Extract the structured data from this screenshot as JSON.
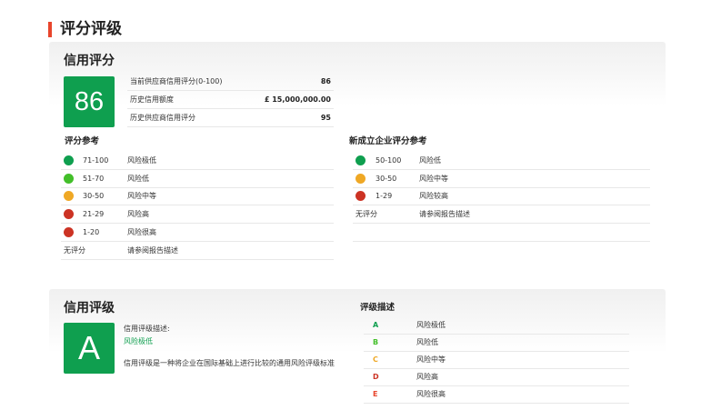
{
  "page_title": "评分评级",
  "colors": {
    "accent": "#e8452c",
    "green_dark": "#0f9f4f",
    "green_light": "#43bf2a",
    "amber": "#efa825",
    "red": "#cc3324"
  },
  "credit_score": {
    "title": "信用评分",
    "score": "86",
    "rows": [
      {
        "label": "当前供应商信用评分(0-100)",
        "value": "86"
      },
      {
        "label": "历史信用额度",
        "value": "£ 15,000,000.00"
      },
      {
        "label": "历史供应商信用评分",
        "value": "95"
      }
    ],
    "reference": {
      "title": "评分参考",
      "rows": [
        {
          "range": "71-100",
          "desc": "风险极低",
          "color": "#0f9f4f"
        },
        {
          "range": "51-70",
          "desc": "风险低",
          "color": "#43bf2a"
        },
        {
          "range": "30-50",
          "desc": "风险中等",
          "color": "#efa825"
        },
        {
          "range": "21-29",
          "desc": "风险高",
          "color": "#cc3324"
        },
        {
          "range": "1-20",
          "desc": "风险很高",
          "color": "#cc3324"
        }
      ],
      "unrated": {
        "label": "无评分",
        "desc": "请参阅报告描述"
      }
    },
    "new_company_reference": {
      "title": "新成立企业评分参考",
      "rows": [
        {
          "range": "50-100",
          "desc": "风险低",
          "color": "#0f9f4f"
        },
        {
          "range": "30-50",
          "desc": "风险中等",
          "color": "#efa825"
        },
        {
          "range": "1-29",
          "desc": "风险较高",
          "color": "#cc3324"
        }
      ],
      "unrated": {
        "label": "无评分",
        "desc": "请参阅报告描述"
      }
    }
  },
  "credit_rating": {
    "title": "信用评级",
    "grade": "A",
    "desc_label": "信用评级描述:",
    "desc_value": "风险极低",
    "desc_value_color": "#0f9f4f",
    "note": "信用评级是一种将企业在国际基础上进行比较的通用风险评级标准",
    "grade_desc": {
      "title": "评级描述",
      "rows": [
        {
          "grade": "A",
          "desc": "风险极低",
          "color": "#0f9f4f"
        },
        {
          "grade": "B",
          "desc": "风险低",
          "color": "#43bf2a"
        },
        {
          "grade": "C",
          "desc": "风险中等",
          "color": "#efa825"
        },
        {
          "grade": "D",
          "desc": "风险高",
          "color": "#cc3324"
        },
        {
          "grade": "E",
          "desc": "风险很高",
          "color": "#e8452c"
        }
      ]
    }
  }
}
